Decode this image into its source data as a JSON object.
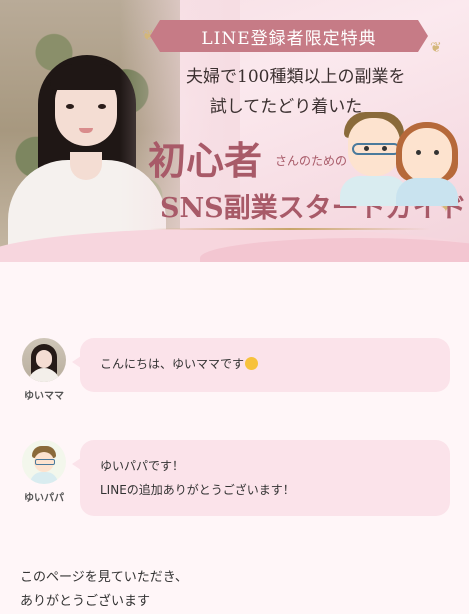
{
  "hero": {
    "badge": "LINE登録者限定特典",
    "subtitle_line1": "夫婦で100種類以上の副業を",
    "subtitle_line2": "試してたどり着いた",
    "title_big": "初心者",
    "title_small": "さんのための",
    "title_main": "SNS副業スタートガイド"
  },
  "chat": {
    "messages": [
      {
        "name": "ゆいママ",
        "lines": [
          "こんにちは、ゆいママです"
        ]
      },
      {
        "name": "ゆいパパ",
        "lines": [
          "ゆいパパです！",
          "LINEの追加ありがとうございます！"
        ]
      }
    ]
  },
  "intro": {
    "lines": [
      "このページを見ていただき、",
      "ありがとうございます"
    ]
  },
  "colors": {
    "badge": "#c67b86",
    "title": "#a85a68",
    "bubble": "#fbe3ea",
    "background": "#fff6f8"
  },
  "icons": [
    "smile-emoji-icon",
    "sparkle-icon"
  ]
}
